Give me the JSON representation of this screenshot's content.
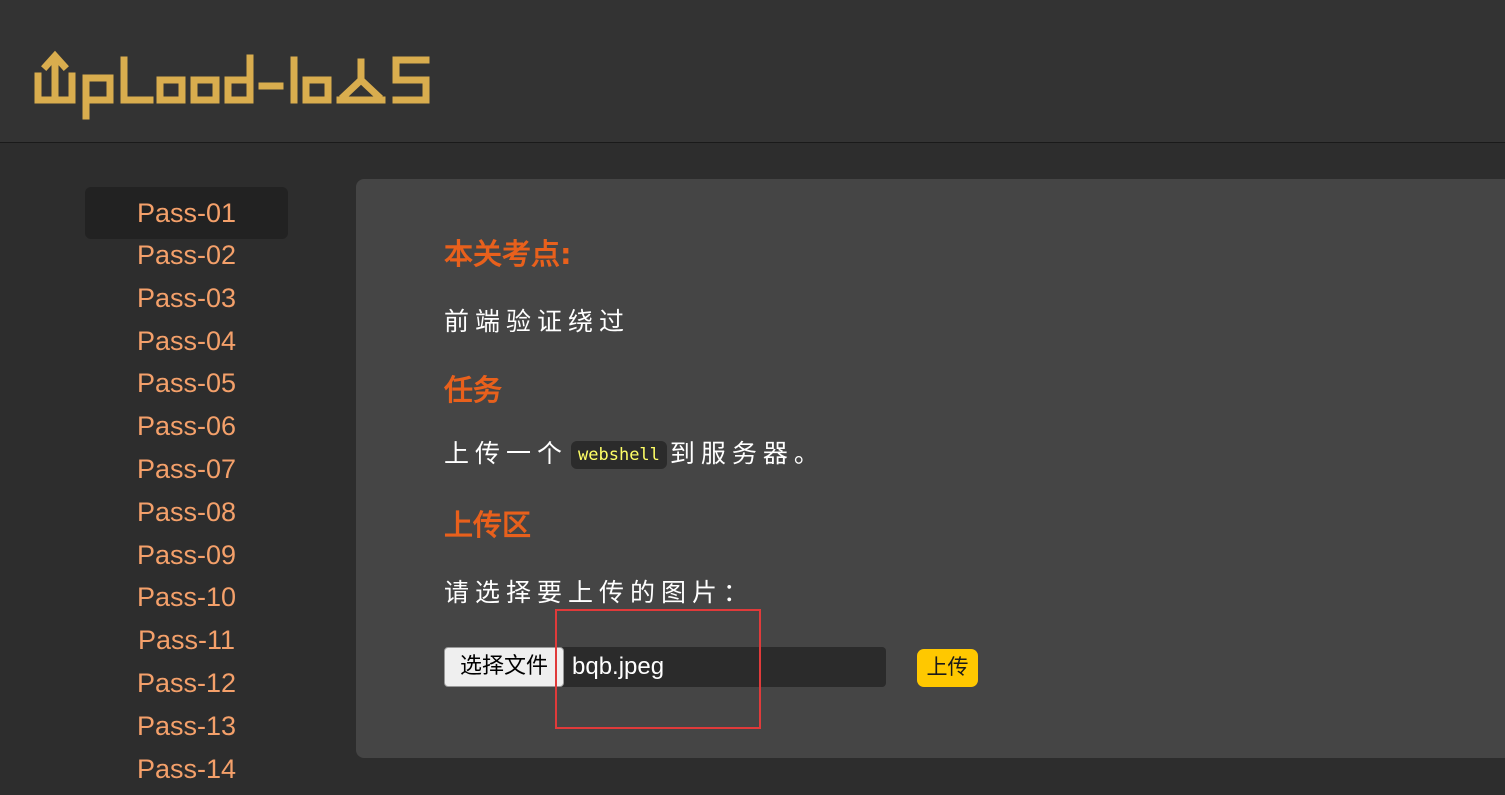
{
  "app": {
    "logo_text": "UpLoad-labS",
    "logo_color": "#d9ad4e"
  },
  "sidebar": {
    "items": [
      {
        "label": "Pass-01",
        "active": true
      },
      {
        "label": "Pass-02"
      },
      {
        "label": "Pass-03"
      },
      {
        "label": "Pass-04"
      },
      {
        "label": "Pass-05"
      },
      {
        "label": "Pass-06"
      },
      {
        "label": "Pass-07"
      },
      {
        "label": "Pass-08"
      },
      {
        "label": "Pass-09"
      },
      {
        "label": "Pass-10"
      },
      {
        "label": "Pass-11"
      },
      {
        "label": "Pass-12"
      },
      {
        "label": "Pass-13"
      },
      {
        "label": "Pass-14"
      }
    ]
  },
  "main": {
    "section1_title": "本关考点:",
    "section1_text": "前端验证绕过",
    "section2_title": "任务",
    "task_prefix": "上传一个",
    "task_code": "webshell",
    "task_suffix": "到服务器。",
    "section3_title": "上传区",
    "upload_prompt": "请选择要上传的图片：",
    "file_button_label": "选择文件",
    "file_name": "bqb.jpeg",
    "upload_button_label": "上传"
  },
  "colors": {
    "accent_orange": "#e8601c",
    "sidebar_link": "#f4a06a",
    "upload_button": "#ffc800",
    "highlight_box": "#e03a3a"
  }
}
